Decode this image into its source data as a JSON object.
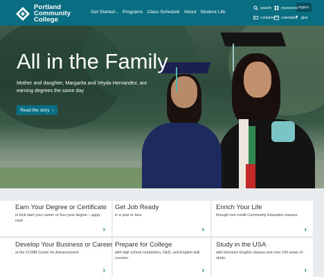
{
  "header": {
    "logo_lines": [
      "Portland",
      "Community",
      "College"
    ],
    "nav": [
      {
        "label": "Get Started",
        "caret": "⌄"
      },
      {
        "label": "Programs"
      },
      {
        "label": "Class Schedule"
      },
      {
        "label": "About"
      },
      {
        "label": "Student Life"
      }
    ],
    "utility": {
      "search": "search",
      "resources": "resources",
      "mypcc": "mypcc",
      "contacts": "contacts",
      "calendars": "calendars",
      "give": "give"
    },
    "brand_color": "#0a6e82"
  },
  "hero": {
    "title": "All in the Family",
    "subtitle": "Mother and daughter, Margarita and Veyda Hernandez, are earning degrees the same day",
    "button": "Read the story",
    "button_arrow": "›"
  },
  "cards": [
    {
      "title": "Earn Your Degree or Certificate",
      "desc": "to kick-start your career or four-year degree – apply now!"
    },
    {
      "title": "Get Job Ready",
      "desc": "in a year or less."
    },
    {
      "title": "Enrich Your Life",
      "desc": "through non-credit Community Education classes."
    },
    {
      "title": "Develop Your Business or Career",
      "desc": "at the CLIMB Center for Advancement."
    },
    {
      "title": "Prepare for College",
      "desc": "with high school completion, GED, and English skill courses."
    },
    {
      "title": "Study in the USA",
      "desc": "with intensive English classes and over 100 areas of study."
    }
  ],
  "card_arrow": "›"
}
